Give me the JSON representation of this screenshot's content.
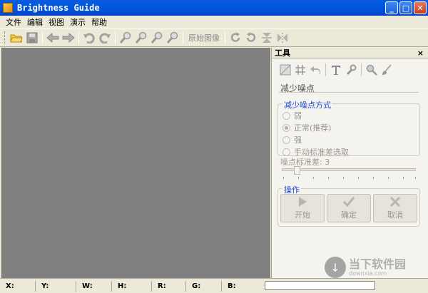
{
  "window": {
    "title": "Brightness Guide"
  },
  "menu": [
    "文件",
    "编辑",
    "视图",
    "演示",
    "帮助"
  ],
  "toolbar": {
    "original_image_label": "原始图像"
  },
  "panel": {
    "title": "工具",
    "close": "×",
    "section_title": "减少噪点",
    "method_group": {
      "legend": "减少噪点方式",
      "options": [
        "弱",
        "正常(推荐)",
        "强",
        "手动标准差选取"
      ],
      "selected": "正常(推荐)"
    },
    "slider": {
      "label": "噪点标准差",
      "value": "3"
    },
    "operations": {
      "legend": "操作",
      "buttons": [
        "开始",
        "确定",
        "取消"
      ]
    }
  },
  "statusbar": {
    "labels": [
      "X:",
      "Y:",
      "W:",
      "H:",
      "R:",
      "G:",
      "B:"
    ]
  },
  "watermark": {
    "text": "当下软件园",
    "sub": "downxia.com"
  }
}
